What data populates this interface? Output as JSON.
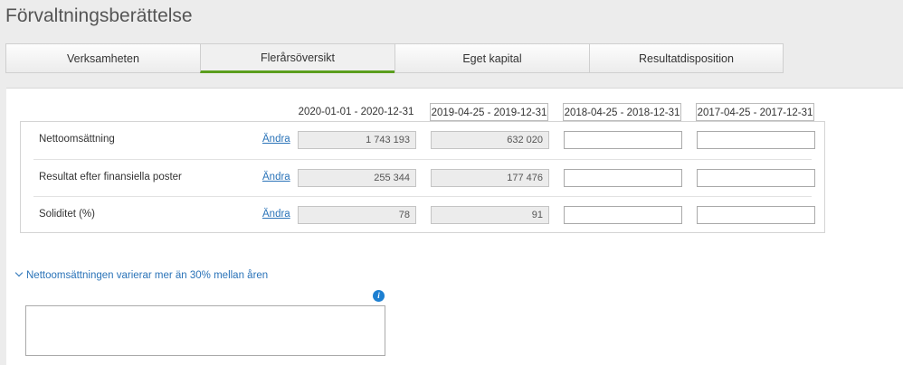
{
  "page": {
    "title": "Förvaltningsberättelse"
  },
  "tabs": [
    {
      "label": "Verksamheten"
    },
    {
      "label": "Flerårsöversikt"
    },
    {
      "label": "Eget kapital"
    },
    {
      "label": "Resultatdisposition"
    }
  ],
  "active_tab": "Flerårsöversikt",
  "periods": [
    "2020-01-01 - 2020-12-31",
    "2019-04-25 - 2019-12-31",
    "2018-04-25 - 2018-12-31",
    "2017-04-25 - 2017-12-31"
  ],
  "rows": [
    {
      "label": "Nettoomsättning",
      "link": "Ändra",
      "values": [
        "1 743 193",
        "632 020",
        "",
        ""
      ]
    },
    {
      "label": "Resultat efter finansiella poster",
      "link": "Ändra",
      "values": [
        "255 344",
        "177 476",
        "",
        ""
      ]
    },
    {
      "label": "Soliditet (%)",
      "link": "Ändra",
      "values": [
        "78",
        "91",
        "",
        ""
      ]
    }
  ],
  "warning": {
    "text": "Nettoomsättningen varierar mer än 30% mellan åren",
    "icon": "chevron-down-icon"
  },
  "info": {
    "icon": "info-icon",
    "glyph": "i"
  },
  "comment": {
    "value": ""
  },
  "colors": {
    "accent": "#5a9e1e",
    "link": "#2a73b8",
    "info": "#1d7fd1"
  }
}
